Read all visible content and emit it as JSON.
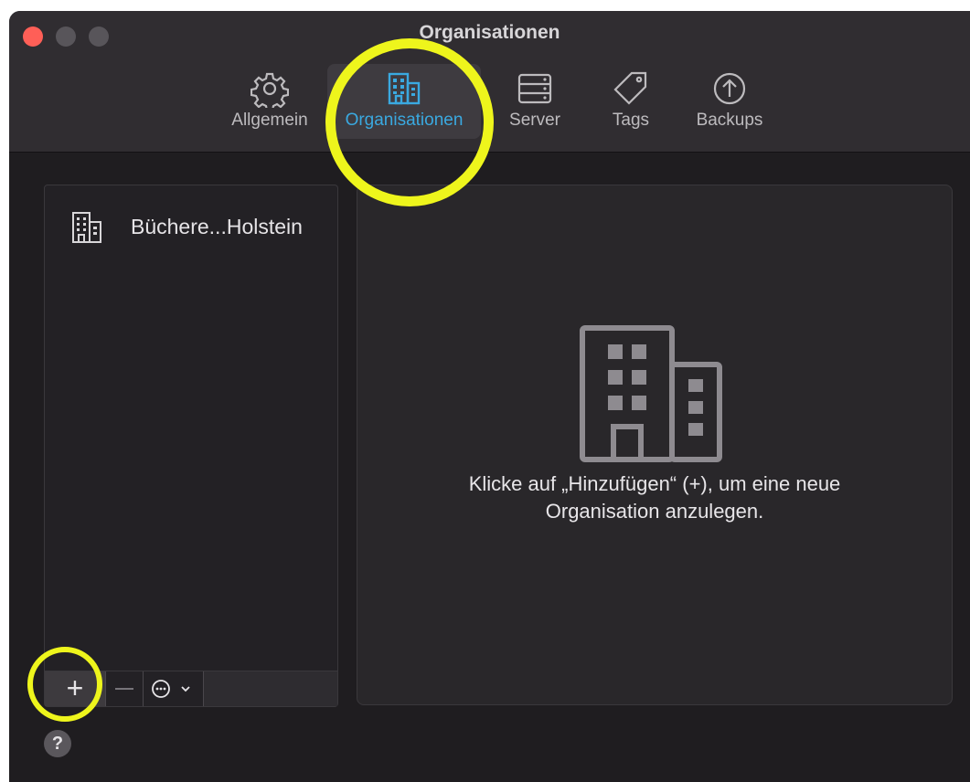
{
  "window": {
    "title": "Organisationen",
    "close_color": "#ff5f57",
    "accent_color": "#3aa9e0",
    "highlight_color": "#eef51c"
  },
  "toolbar": {
    "tabs": [
      {
        "label": "Allgemein",
        "icon": "gear-icon",
        "active": false
      },
      {
        "label": "Organisationen",
        "icon": "building-icon",
        "active": true
      },
      {
        "label": "Server",
        "icon": "server-icon",
        "active": false
      },
      {
        "label": "Tags",
        "icon": "tag-icon",
        "active": false
      },
      {
        "label": "Backups",
        "icon": "upload-circle-icon",
        "active": false
      }
    ]
  },
  "sidebar": {
    "items": [
      {
        "label": "Büchere...Holstein",
        "icon": "building-icon"
      }
    ],
    "toolbar": {
      "add_label": "+",
      "remove_icon": "minus-icon",
      "more_icon": "ellipsis-circle-icon"
    }
  },
  "content": {
    "empty_icon": "building-icon",
    "message_line1": "Klicke auf „Hinzufügen“ (+), um eine neue",
    "message_line2": "Organisation anzulegen."
  },
  "help": {
    "label": "?"
  }
}
